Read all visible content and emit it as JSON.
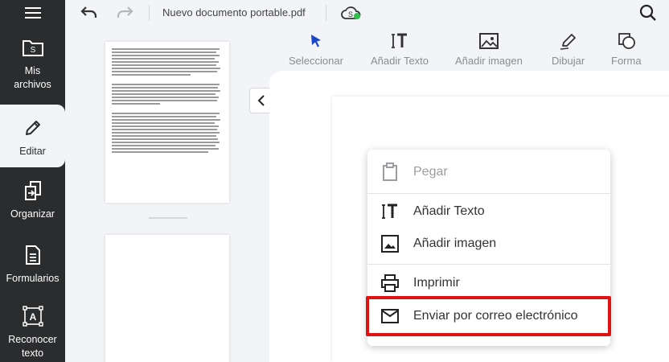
{
  "sidebar": {
    "items": [
      {
        "label_1": "Mis",
        "label_2": "archivos"
      },
      {
        "label": "Editar"
      },
      {
        "label": "Organizar"
      },
      {
        "label": "Formularios"
      },
      {
        "label_1": "Reconocer",
        "label_2": "texto"
      }
    ]
  },
  "topbar": {
    "doc_title": "Nuevo documento portable.pdf"
  },
  "tools": [
    {
      "label": "Seleccionar"
    },
    {
      "label": "Añadir Texto"
    },
    {
      "label": "Añadir imagen"
    },
    {
      "label": "Dibujar"
    },
    {
      "label": "Forma"
    }
  ],
  "context_menu": {
    "items": [
      {
        "label": "Pegar",
        "enabled": false
      },
      {
        "label": "Añadir Texto",
        "enabled": true
      },
      {
        "label": "Añadir imagen",
        "enabled": true
      },
      {
        "label": "Imprimir",
        "enabled": true
      },
      {
        "label": "Enviar por correo electrónico",
        "enabled": true,
        "highlighted": true
      }
    ]
  },
  "colors": {
    "sidebar_bg": "#2b2c2e",
    "select_tool": "#1a47c9",
    "highlight_border": "#e11212",
    "cloud_badge": "#2fbf4a"
  }
}
